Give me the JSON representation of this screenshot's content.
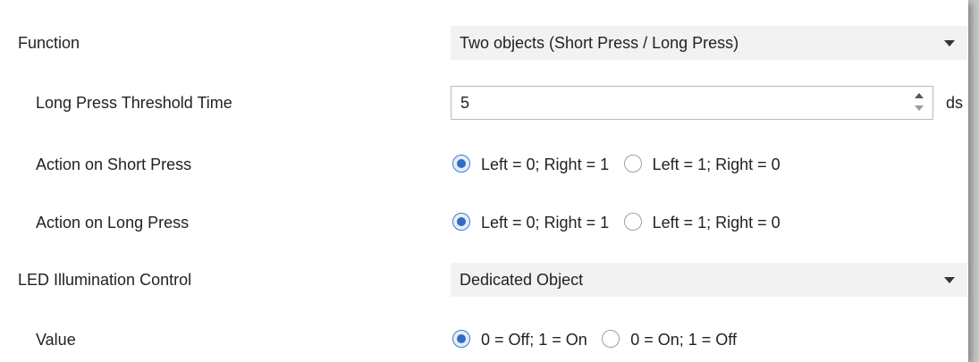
{
  "rows": {
    "function": {
      "label": "Function",
      "value": "Two objects (Short Press / Long Press)"
    },
    "threshold": {
      "label": "Long Press Threshold Time",
      "value": "5",
      "unit": "ds"
    },
    "short_press": {
      "label": "Action on Short Press",
      "options": [
        "Left = 0; Right = 1",
        "Left = 1; Right = 0"
      ],
      "selected": 0
    },
    "long_press": {
      "label": "Action on Long Press",
      "options": [
        "Left = 0; Right = 1",
        "Left = 1; Right = 0"
      ],
      "selected": 0
    },
    "led_control": {
      "label": "LED Illumination Control",
      "value": "Dedicated Object"
    },
    "value": {
      "label": "Value",
      "options": [
        "0 = Off; 1 = On",
        "0 = On; 1 = Off"
      ],
      "selected": 0
    }
  },
  "colors": {
    "radio_selected": "#2f6cc8",
    "dropdown_bg": "#f2f2f2"
  },
  "icons": {
    "dropdown": "caret-down-icon",
    "spinner": "up-down-arrows-icon"
  }
}
